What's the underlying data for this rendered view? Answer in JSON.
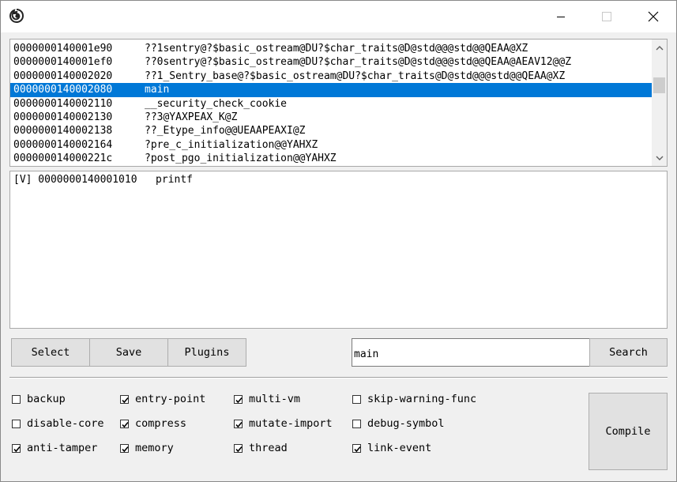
{
  "window": {
    "icon": "app-logo-icon",
    "controls": [
      "minimize-icon",
      "maximize-icon",
      "close-icon"
    ]
  },
  "symbols": [
    {
      "addr": "0000000140001e90",
      "name": "??1sentry@?$basic_ostream@DU?$char_traits@D@std@@@std@@QEAA@XZ",
      "selected": false
    },
    {
      "addr": "0000000140001ef0",
      "name": "??0sentry@?$basic_ostream@DU?$char_traits@D@std@@@std@@QEAA@AEAV12@@Z",
      "selected": false
    },
    {
      "addr": "0000000140002020",
      "name": "??1_Sentry_base@?$basic_ostream@DU?$char_traits@D@std@@@std@@QEAA@XZ",
      "selected": false
    },
    {
      "addr": "0000000140002080",
      "name": "main",
      "selected": true
    },
    {
      "addr": "0000000140002110",
      "name": "__security_check_cookie",
      "selected": false
    },
    {
      "addr": "0000000140002130",
      "name": "??3@YAXPEAX_K@Z",
      "selected": false
    },
    {
      "addr": "0000000140002138",
      "name": "??_Etype_info@@UEAAPEAXI@Z",
      "selected": false
    },
    {
      "addr": "0000000140002164",
      "name": "?pre_c_initialization@@YAHXZ",
      "selected": false
    },
    {
      "addr": "000000014000221c",
      "name": "?post_pgo_initialization@@YAHXZ",
      "selected": false
    }
  ],
  "output_text": "[V] 0000000140001010   printf",
  "buttons": {
    "select": "Select",
    "save": "Save",
    "plugins": "Plugins",
    "search": "Search",
    "compile": "Compile"
  },
  "search": {
    "value": "main"
  },
  "options": {
    "backup": {
      "label": "backup",
      "checked": false
    },
    "entry_point": {
      "label": "entry-point",
      "checked": true
    },
    "multi_vm": {
      "label": "multi-vm",
      "checked": true
    },
    "skip_warning_func": {
      "label": "skip-warning-func",
      "checked": false
    },
    "disable_core": {
      "label": "disable-core",
      "checked": false
    },
    "compress": {
      "label": "compress",
      "checked": true
    },
    "mutate_import": {
      "label": "mutate-import",
      "checked": true
    },
    "debug_symbol": {
      "label": "debug-symbol",
      "checked": false
    },
    "anti_tamper": {
      "label": "anti-tamper",
      "checked": true
    },
    "memory": {
      "label": "memory",
      "checked": true
    },
    "thread": {
      "label": "thread",
      "checked": true
    },
    "link_event": {
      "label": "link-event",
      "checked": true
    }
  },
  "colors": {
    "selection": "#0078d7",
    "button_face": "#e1e1e1"
  }
}
